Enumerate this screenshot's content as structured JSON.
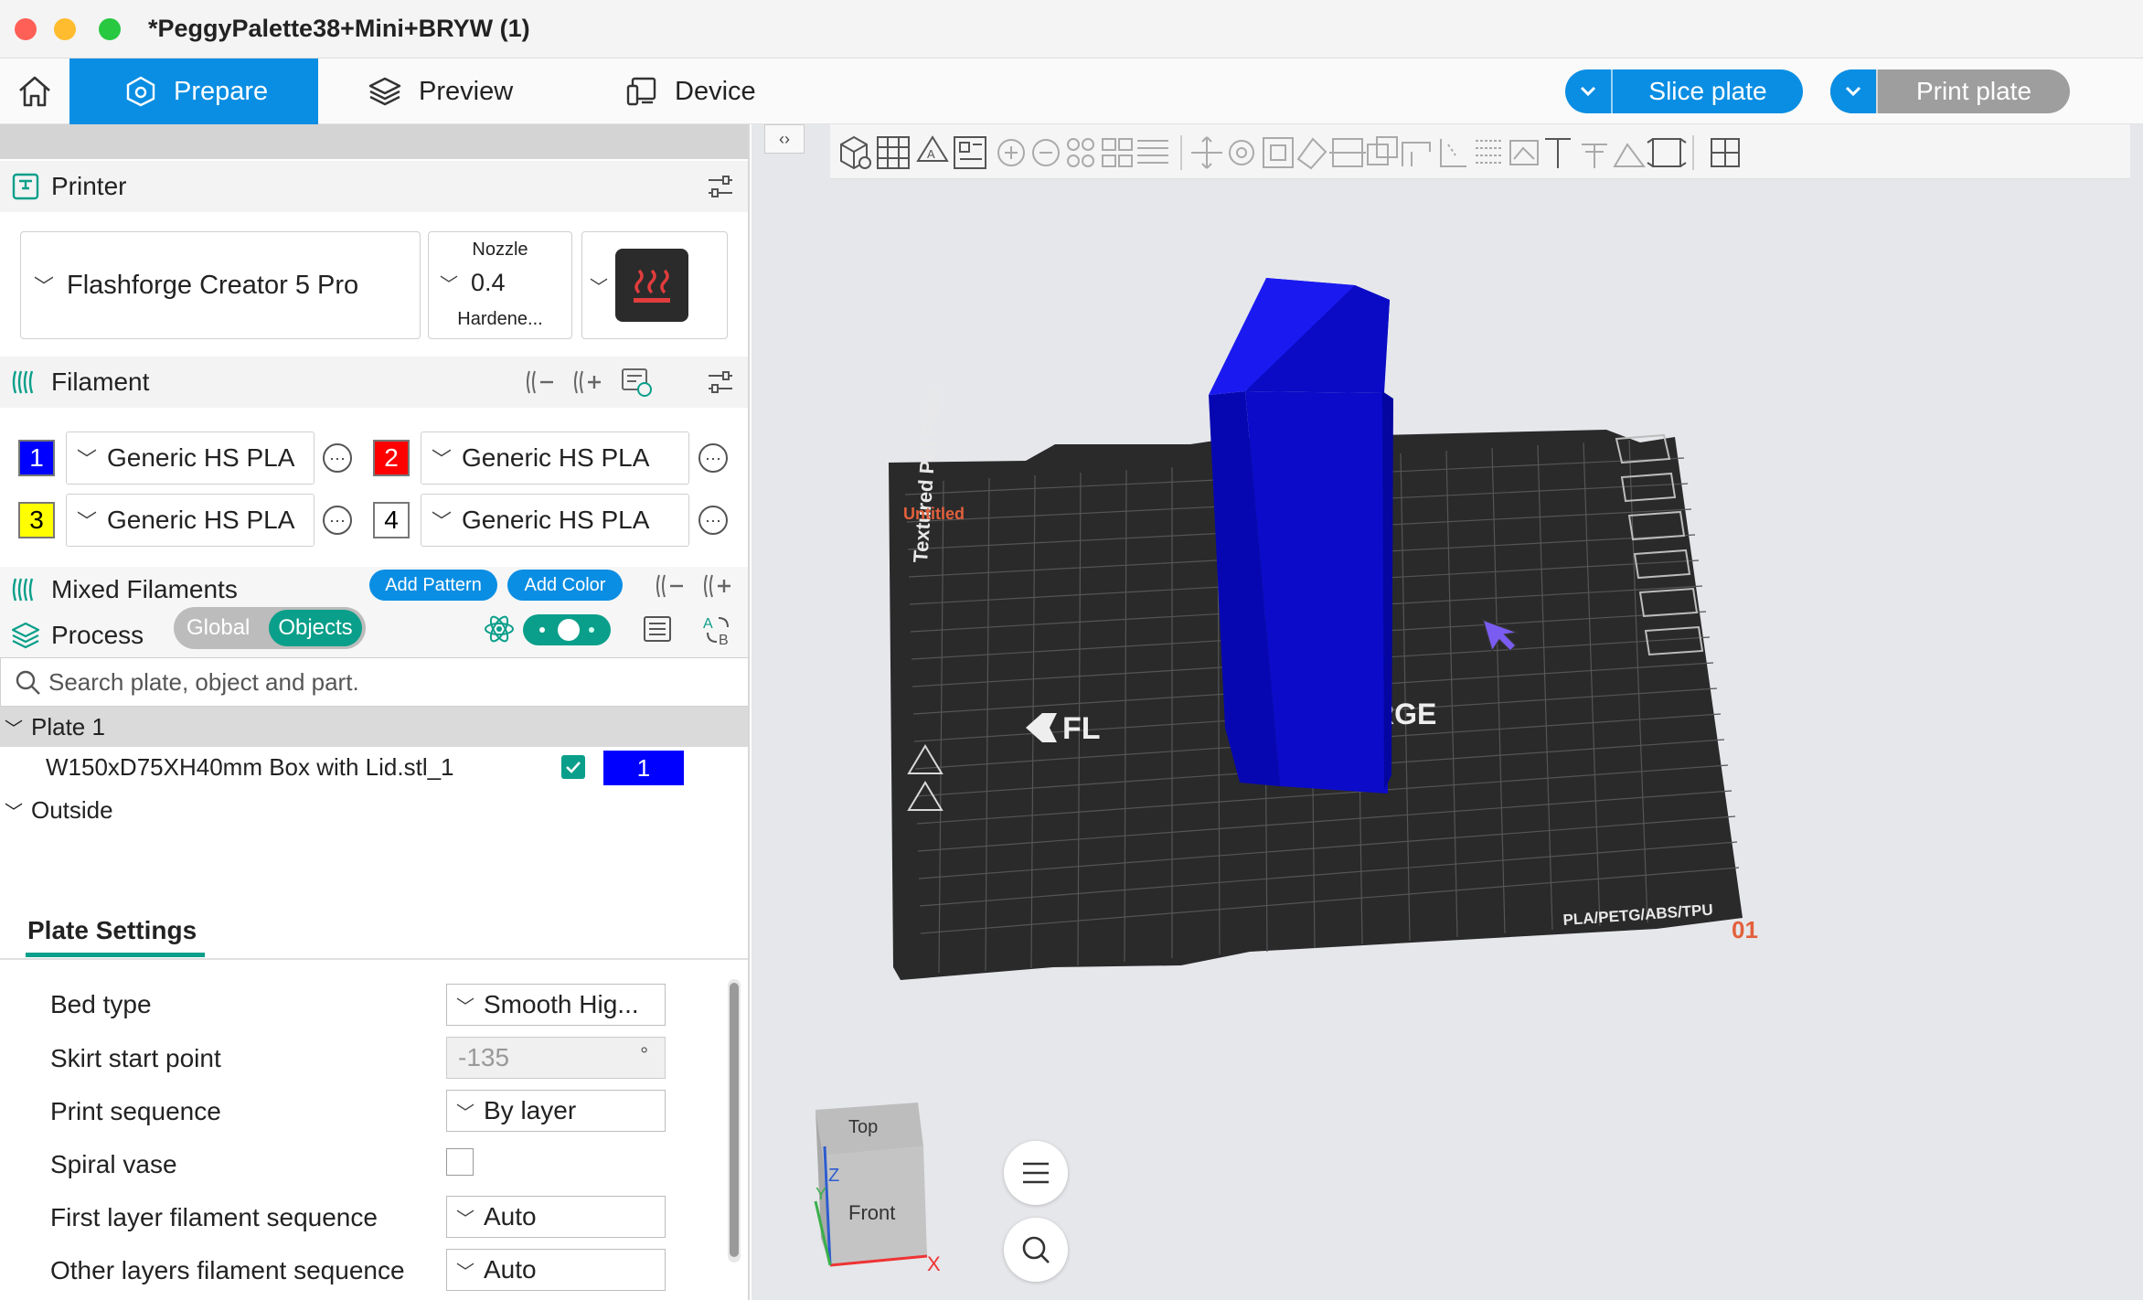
{
  "window": {
    "title": "*PeggyPalette38+Mini+BRYW (1)"
  },
  "tabs": {
    "prepare": "Prepare",
    "preview": "Preview",
    "device": "Device"
  },
  "actions": {
    "slice": "Slice plate",
    "print": "Print plate"
  },
  "printer": {
    "section": "Printer",
    "model": "Flashforge Creator 5 Pro",
    "nozzle_label": "Nozzle",
    "nozzle_value": "0.4",
    "nozzle_type": "Hardene..."
  },
  "filament": {
    "section": "Filament",
    "slots": [
      {
        "num": "1",
        "name": "Generic HS PLA",
        "color": "#0000ff",
        "text_color": "#ffffff"
      },
      {
        "num": "2",
        "name": "Generic HS PLA",
        "color": "#ff0000",
        "text_color": "#ffffff"
      },
      {
        "num": "3",
        "name": "Generic HS PLA",
        "color": "#ffff00",
        "text_color": "#000000"
      },
      {
        "num": "4",
        "name": "Generic HS PLA",
        "color": "#ffffff",
        "text_color": "#000000"
      }
    ]
  },
  "mixed": {
    "section": "Mixed Filaments",
    "add_pattern": "Add Pattern",
    "add_color": "Add Color"
  },
  "process": {
    "section": "Process",
    "global": "Global",
    "objects": "Objects"
  },
  "search": {
    "placeholder": "Search plate, object and part."
  },
  "tree": {
    "plate": "Plate 1",
    "object": "W150xD75XH40mm Box with Lid.stl_1",
    "object_filament": "1",
    "outside": "Outside"
  },
  "plate_settings": {
    "title": "Plate Settings",
    "bed_type_label": "Bed type",
    "bed_type_value": "Smooth Hig...",
    "skirt_label": "Skirt start point",
    "skirt_value": "-135",
    "skirt_unit": "°",
    "seq_label": "Print sequence",
    "seq_value": "By layer",
    "spiral_label": "Spiral vase",
    "first_layer_label": "First layer filament sequence",
    "first_layer_value": "Auto",
    "other_layers_label": "Other layers filament sequence",
    "other_layers_value": "Auto"
  },
  "scene": {
    "plate_name": "Textured PEI Plate",
    "brand_left": "FL",
    "brand_right": "RGE",
    "materials": "PLA/PETG/ABS/TPU",
    "plate_num": "01",
    "plate_tag": "Untitled",
    "cube_top": "Top",
    "cube_front": "Front",
    "axis_z": "Z",
    "axis_y": "Y",
    "axis_x": "X"
  },
  "colors": {
    "accent": "#0a8ee3",
    "object": "#0a0ad6"
  }
}
